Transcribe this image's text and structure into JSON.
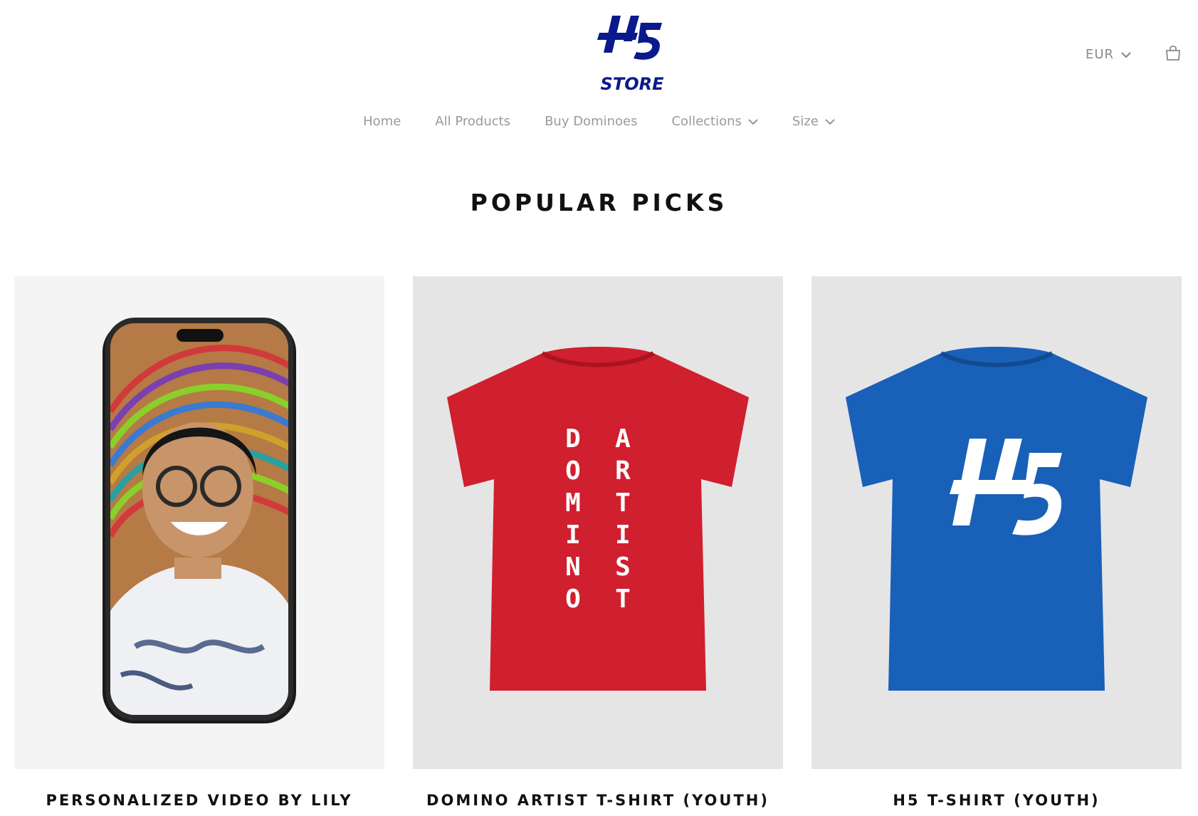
{
  "store": {
    "logo_text": "STORE",
    "brand_color": "#0a1a8c"
  },
  "utility": {
    "currency": "EUR",
    "currency_icon": "chevron-down-icon",
    "cart_icon": "shopping-bag-icon"
  },
  "nav": {
    "items": [
      {
        "label": "Home"
      },
      {
        "label": "All Products"
      },
      {
        "label": "Buy Dominoes"
      },
      {
        "label": "Collections",
        "has_dropdown": true
      },
      {
        "label": "Size",
        "has_dropdown": true
      }
    ]
  },
  "section": {
    "title": "POPULAR PICKS"
  },
  "products": [
    {
      "title": "PERSONALIZED VIDEO BY LILY",
      "image": "smartphone-video-photo"
    },
    {
      "title": "DOMINO ARTIST T-SHIRT (YOUTH)",
      "image": "red-tshirt-photo",
      "shirt_color": "#d01f2e"
    },
    {
      "title": "H5 T-SHIRT (YOUTH)",
      "image": "blue-tshirt-photo",
      "shirt_color": "#1860b8"
    }
  ]
}
